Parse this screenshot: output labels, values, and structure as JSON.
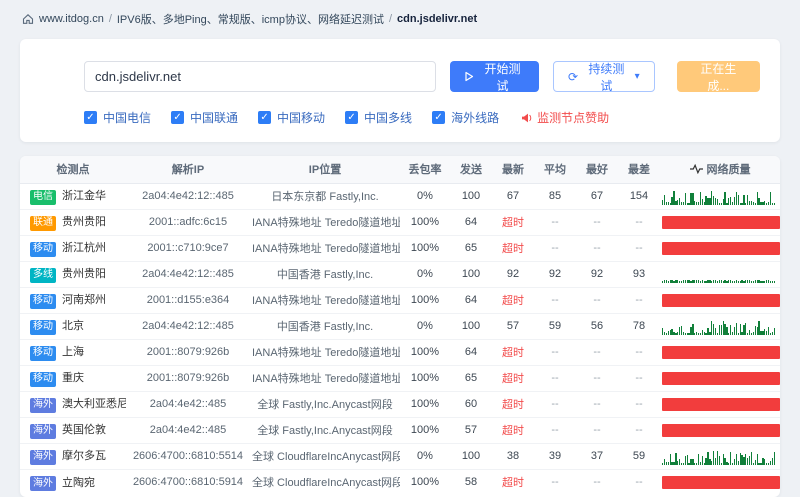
{
  "breadcrumb": {
    "site": "www.itdog.cn",
    "separator": "/",
    "path": "IPV6版、多地Ping、常规版、icmp协议、网络延迟测试",
    "target": "cdn.jsdelivr.net"
  },
  "toolbar": {
    "input_value": "cdn.jsdelivr.net",
    "start_label": "开始测试",
    "continuous_label": "持续测试",
    "generating_label": "正在生成...",
    "primary_color": "#3e7bfa",
    "warning_color": "#ffc97a"
  },
  "filters": {
    "items": [
      "中国电信",
      "中国联通",
      "中国移动",
      "中国多线",
      "海外线路"
    ],
    "all_checked": true,
    "sponsor_label": "监测节点赞助",
    "sponsor_color": "#f24c4c"
  },
  "table": {
    "headers": [
      "检测点",
      "解析IP",
      "IP位置",
      "丢包率",
      "发送",
      "最新",
      "平均",
      "最好",
      "最差",
      "网络质量"
    ],
    "timeout_label": "超时",
    "badge_colors": {
      "电信": "#19be6b",
      "联通": "#ff9900",
      "移动": "#2d8cf0",
      "多线": "#00b5c4",
      "海外": "#5e7ce0"
    },
    "quality_colors": {
      "good": "#11803a",
      "bad": "#f23d3d"
    },
    "rows": [
      {
        "carrier": "电信",
        "node": "浙江金华",
        "ip": "2a04:4e42:12::485",
        "location": "日本东京都 Fastly,Inc.",
        "loss": "0%",
        "sent": "100",
        "latest": "67",
        "avg": "85",
        "best": "67",
        "worst": "154",
        "quality": "good"
      },
      {
        "carrier": "联通",
        "node": "贵州贵阳",
        "ip": "2001::adfc:6c15",
        "location": "IANA特殊地址 Teredo隧道地址",
        "loss": "100%",
        "sent": "64",
        "latest": "超时",
        "avg": "--",
        "best": "--",
        "worst": "--",
        "quality": "bad"
      },
      {
        "carrier": "移动",
        "node": "浙江杭州",
        "ip": "2001::c710:9ce7",
        "location": "IANA特殊地址 Teredo隧道地址",
        "loss": "100%",
        "sent": "65",
        "latest": "超时",
        "avg": "--",
        "best": "--",
        "worst": "--",
        "quality": "bad"
      },
      {
        "carrier": "多线",
        "node": "贵州贵阳",
        "ip": "2a04:4e42:12::485",
        "location": "中国香港 Fastly,Inc.",
        "loss": "0%",
        "sent": "100",
        "latest": "92",
        "avg": "92",
        "best": "92",
        "worst": "93",
        "quality": "good"
      },
      {
        "carrier": "移动",
        "node": "河南郑州",
        "ip": "2001::d155:e364",
        "location": "IANA特殊地址 Teredo隧道地址",
        "loss": "100%",
        "sent": "64",
        "latest": "超时",
        "avg": "--",
        "best": "--",
        "worst": "--",
        "quality": "bad"
      },
      {
        "carrier": "移动",
        "node": "北京",
        "ip": "2a04:4e42:12::485",
        "location": "中国香港 Fastly,Inc.",
        "loss": "0%",
        "sent": "100",
        "latest": "57",
        "avg": "59",
        "best": "56",
        "worst": "78",
        "quality": "good"
      },
      {
        "carrier": "移动",
        "node": "上海",
        "ip": "2001::8079:926b",
        "location": "IANA特殊地址 Teredo隧道地址",
        "loss": "100%",
        "sent": "64",
        "latest": "超时",
        "avg": "--",
        "best": "--",
        "worst": "--",
        "quality": "bad"
      },
      {
        "carrier": "移动",
        "node": "重庆",
        "ip": "2001::8079:926b",
        "location": "IANA特殊地址 Teredo隧道地址",
        "loss": "100%",
        "sent": "65",
        "latest": "超时",
        "avg": "--",
        "best": "--",
        "worst": "--",
        "quality": "bad"
      },
      {
        "carrier": "海外",
        "node": "澳大利亚悉尼",
        "ip": "2a04:4e42::485",
        "location": "全球 Fastly,Inc.Anycast网段",
        "loss": "100%",
        "sent": "60",
        "latest": "超时",
        "avg": "--",
        "best": "--",
        "worst": "--",
        "quality": "bad"
      },
      {
        "carrier": "海外",
        "node": "英国伦敦",
        "ip": "2a04:4e42::485",
        "location": "全球 Fastly,Inc.Anycast网段",
        "loss": "100%",
        "sent": "57",
        "latest": "超时",
        "avg": "--",
        "best": "--",
        "worst": "--",
        "quality": "bad"
      },
      {
        "carrier": "海外",
        "node": "摩尔多瓦",
        "ip": "2606:4700::6810:5514",
        "location": "全球 CloudflareIncAnycast网段",
        "loss": "0%",
        "sent": "100",
        "latest": "38",
        "avg": "39",
        "best": "37",
        "worst": "59",
        "quality": "good"
      },
      {
        "carrier": "海外",
        "node": "立陶宛",
        "ip": "2606:4700::6810:5914",
        "location": "全球 CloudflareIncAnycast网段",
        "loss": "100%",
        "sent": "58",
        "latest": "超时",
        "avg": "--",
        "best": "--",
        "worst": "--",
        "quality": "bad"
      }
    ]
  }
}
